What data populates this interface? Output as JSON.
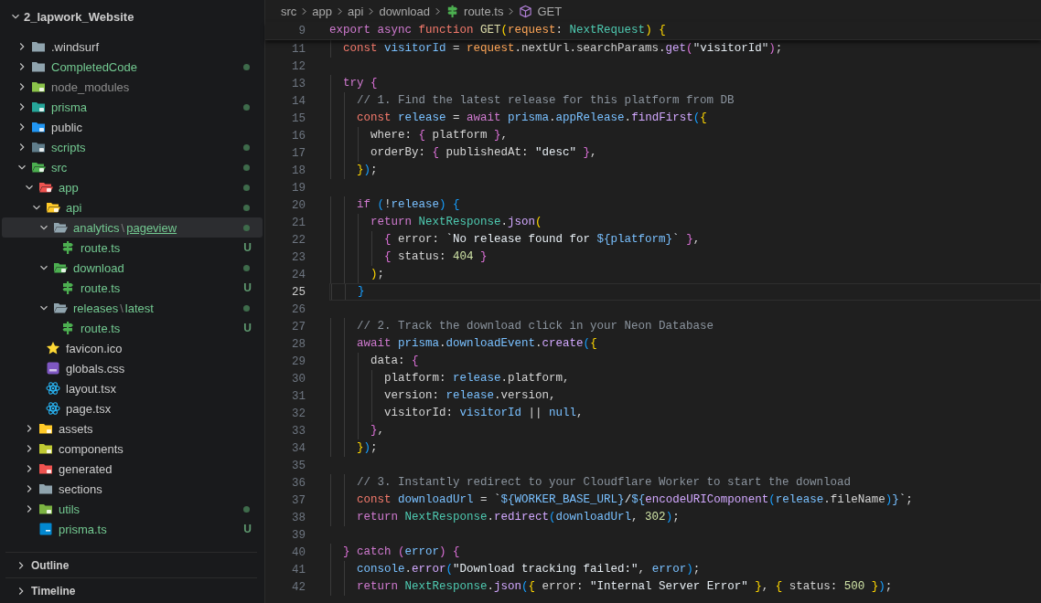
{
  "explorer": {
    "project": {
      "name": "2_lapwork_Website",
      "expanded": true
    },
    "tree": [
      {
        "kind": "folder",
        "name": ".windsurf",
        "color": "#cccccc",
        "expanded": false,
        "selected": false
      },
      {
        "kind": "folder",
        "name": "CompletedCode",
        "color": "#73c991",
        "dot": true,
        "expanded": false,
        "selected": false
      },
      {
        "kind": "nodefolder",
        "name": "node_modules",
        "color": "#8c8c8c",
        "expanded": false,
        "selected": false
      },
      {
        "kind": "prismafolder",
        "name": "prisma",
        "color": "#73c991",
        "dot": true,
        "expanded": false,
        "selected": false
      },
      {
        "kind": "publicfolder",
        "name": "public",
        "color": "#cccccc",
        "expanded": false,
        "selected": false
      },
      {
        "kind": "scriptsfolder",
        "name": "scripts",
        "color": "#73c991",
        "dot": true,
        "expanded": false,
        "selected": false
      },
      {
        "kind": "srcfolder",
        "name": "src",
        "color": "#73c991",
        "dot": true,
        "expanded": true,
        "selected": false,
        "children": [
          {
            "kind": "appfolder",
            "name": "app",
            "color": "#73c991",
            "dot": true,
            "expanded": true,
            "selected": false,
            "children": [
              {
                "kind": "apifolder",
                "name": "api",
                "color": "#73c991",
                "dot": true,
                "expanded": true,
                "selected": false,
                "children": [
                  {
                    "kind": "folder",
                    "parts": [
                      "analytics",
                      "\\",
                      "pageview"
                    ],
                    "color": "#73c991",
                    "dot": true,
                    "expanded": true,
                    "selected": true,
                    "children": [
                      {
                        "kind": "route",
                        "name": "route.ts",
                        "color": "#73c991",
                        "badge": "U",
                        "selected": false
                      }
                    ]
                  },
                  {
                    "kind": "downloadfolder",
                    "name": "download",
                    "color": "#73c991",
                    "dot": true,
                    "expanded": true,
                    "selected": false,
                    "children": [
                      {
                        "kind": "route",
                        "name": "route.ts",
                        "color": "#73c991",
                        "badge": "U",
                        "selected": false
                      }
                    ]
                  },
                  {
                    "kind": "folder",
                    "parts": [
                      "releases",
                      "\\",
                      "latest"
                    ],
                    "color": "#73c991",
                    "dot": true,
                    "expanded": true,
                    "selected": false,
                    "children": [
                      {
                        "kind": "route",
                        "name": "route.ts",
                        "color": "#73c991",
                        "badge": "U",
                        "selected": false
                      }
                    ]
                  }
                ]
              },
              {
                "kind": "favicon",
                "name": "favicon.ico",
                "color": "#cccccc",
                "selected": false
              },
              {
                "kind": "stylesheet",
                "name": "globals.css",
                "color": "#cccccc",
                "selected": false
              },
              {
                "kind": "react",
                "name": "layout.tsx",
                "color": "#cccccc",
                "selected": false
              },
              {
                "kind": "react",
                "name": "page.tsx",
                "color": "#cccccc",
                "selected": false
              }
            ]
          },
          {
            "kind": "assetsfolder",
            "name": "assets",
            "color": "#cccccc",
            "expanded": false,
            "selected": false
          },
          {
            "kind": "componentsfolder",
            "name": "components",
            "color": "#cccccc",
            "expanded": false,
            "selected": false
          },
          {
            "kind": "generatedfolder",
            "name": "generated",
            "color": "#cccccc",
            "expanded": false,
            "selected": false
          },
          {
            "kind": "folder",
            "name": "sections",
            "color": "#cccccc",
            "expanded": false,
            "selected": false
          },
          {
            "kind": "utilsfolder",
            "name": "utils",
            "color": "#73c991",
            "dot": true,
            "expanded": false,
            "selected": false
          },
          {
            "kind": "typescript",
            "name": "prisma.ts",
            "color": "#73c991",
            "badge": "U",
            "selected": false
          }
        ]
      }
    ]
  },
  "panels": [
    {
      "title": "Outline",
      "expanded": false
    },
    {
      "title": "Timeline",
      "expanded": false
    }
  ],
  "editor": {
    "breadcrumbs": [
      {
        "text": "src"
      },
      {
        "text": "app"
      },
      {
        "text": "api"
      },
      {
        "text": "download"
      },
      {
        "text": "route.ts",
        "kind": "route"
      },
      {
        "text": "GET",
        "kind": "method"
      }
    ],
    "sticky_line": {
      "number": "9",
      "tokens": [
        {
          "kind": "ctl",
          "text": "export "
        },
        {
          "kind": "ctl",
          "text": "async "
        },
        {
          "kind": "kw",
          "text": "function "
        },
        {
          "kind": "fnd",
          "text": "GET"
        },
        {
          "kind": "b1",
          "text": "("
        },
        {
          "kind": "param",
          "text": "request"
        },
        {
          "kind": "p",
          "text": ": "
        },
        {
          "kind": "type",
          "text": "NextRequest"
        },
        {
          "kind": "b1",
          "text": ")"
        },
        {
          "kind": "b1",
          "text": " {"
        }
      ]
    },
    "lines": [
      {
        "number": "11",
        "active": false,
        "tokens": [
          {
            "kind": "kw",
            "text": "  const "
          },
          {
            "kind": "var",
            "text": "visitorId"
          },
          {
            "kind": "p",
            "text": " = "
          },
          {
            "kind": "param",
            "text": "request"
          },
          {
            "kind": "p",
            "text": ".nextUrl.searchParams."
          },
          {
            "kind": "fn",
            "text": "get"
          },
          {
            "kind": "b2",
            "text": "("
          },
          {
            "kind": "str",
            "text": "\"visitorId\""
          },
          {
            "kind": "b2",
            "text": ")"
          },
          {
            "kind": "p",
            "text": ";"
          }
        ]
      },
      {
        "number": "12",
        "active": false
      },
      {
        "number": "13",
        "active": false,
        "tokens": [
          {
            "kind": "ctl",
            "text": "  try "
          },
          {
            "kind": "b2",
            "text": "{"
          }
        ]
      },
      {
        "number": "14",
        "active": false,
        "tokens": [
          {
            "kind": "com",
            "text": "    // 1. Find the latest release for this platform from DB"
          }
        ]
      },
      {
        "number": "15",
        "active": false,
        "tokens": [
          {
            "kind": "kw",
            "text": "    const "
          },
          {
            "kind": "var",
            "text": "release"
          },
          {
            "kind": "p",
            "text": " = "
          },
          {
            "kind": "ctl",
            "text": "await "
          },
          {
            "kind": "var",
            "text": "prisma"
          },
          {
            "kind": "p",
            "text": "."
          },
          {
            "kind": "var",
            "text": "appRelease"
          },
          {
            "kind": "p",
            "text": "."
          },
          {
            "kind": "fn",
            "text": "findFirst"
          },
          {
            "kind": "b3",
            "text": "("
          },
          {
            "kind": "b1",
            "text": "{"
          }
        ]
      },
      {
        "number": "16",
        "active": false,
        "tokens": [
          {
            "kind": "p",
            "text": "      where: "
          },
          {
            "kind": "b2",
            "text": "{"
          },
          {
            "kind": "p",
            "text": " platform "
          },
          {
            "kind": "b2",
            "text": "}"
          },
          {
            "kind": "p",
            "text": ","
          }
        ]
      },
      {
        "number": "17",
        "active": false,
        "tokens": [
          {
            "kind": "p",
            "text": "      orderBy: "
          },
          {
            "kind": "b2",
            "text": "{"
          },
          {
            "kind": "p",
            "text": " publishedAt: "
          },
          {
            "kind": "str",
            "text": "\"desc\" "
          },
          {
            "kind": "b2",
            "text": "}"
          },
          {
            "kind": "p",
            "text": ","
          }
        ]
      },
      {
        "number": "18",
        "active": false,
        "tokens": [
          {
            "kind": "b1",
            "text": "    }"
          },
          {
            "kind": "b3",
            "text": ")"
          },
          {
            "kind": "p",
            "text": ";"
          }
        ]
      },
      {
        "number": "19",
        "active": false
      },
      {
        "number": "20",
        "active": false,
        "tokens": [
          {
            "kind": "ctl",
            "text": "    if "
          },
          {
            "kind": "b3",
            "text": "("
          },
          {
            "kind": "p",
            "text": "!"
          },
          {
            "kind": "var",
            "text": "release"
          },
          {
            "kind": "b3",
            "text": ")"
          },
          {
            "kind": "b3",
            "text": " {"
          }
        ]
      },
      {
        "number": "21",
        "active": false,
        "tokens": [
          {
            "kind": "ctl",
            "text": "      return "
          },
          {
            "kind": "type",
            "text": "NextResponse"
          },
          {
            "kind": "p",
            "text": "."
          },
          {
            "kind": "fn",
            "text": "json"
          },
          {
            "kind": "b1",
            "text": "("
          }
        ]
      },
      {
        "number": "22",
        "active": false,
        "tokens": [
          {
            "kind": "b2",
            "text": "        {"
          },
          {
            "kind": "p",
            "text": " error: "
          },
          {
            "kind": "str",
            "text": "`No release found for "
          },
          {
            "kind": "tpl",
            "text": "${"
          },
          {
            "kind": "var",
            "text": "platform"
          },
          {
            "kind": "tpl",
            "text": "}"
          },
          {
            "kind": "str",
            "text": "` "
          },
          {
            "kind": "b2",
            "text": "}"
          },
          {
            "kind": "p",
            "text": ","
          }
        ]
      },
      {
        "number": "23",
        "active": false,
        "tokens": [
          {
            "kind": "b2",
            "text": "        {"
          },
          {
            "kind": "p",
            "text": " status: "
          },
          {
            "kind": "num",
            "text": "404 "
          },
          {
            "kind": "b2",
            "text": "}"
          }
        ]
      },
      {
        "number": "24",
        "active": false,
        "tokens": [
          {
            "kind": "b1",
            "text": "      )"
          },
          {
            "kind": "p",
            "text": ";"
          }
        ]
      },
      {
        "number": "25",
        "active": true,
        "tokens": [
          {
            "kind": "b3",
            "text": "    }"
          }
        ]
      },
      {
        "number": "26",
        "active": false
      },
      {
        "number": "27",
        "active": false,
        "tokens": [
          {
            "kind": "com",
            "text": "    // 2. Track the download click in your Neon Database"
          }
        ]
      },
      {
        "number": "28",
        "active": false,
        "tokens": [
          {
            "kind": "ctl",
            "text": "    await "
          },
          {
            "kind": "var",
            "text": "prisma"
          },
          {
            "kind": "p",
            "text": "."
          },
          {
            "kind": "var",
            "text": "downloadEvent"
          },
          {
            "kind": "p",
            "text": "."
          },
          {
            "kind": "fn",
            "text": "create"
          },
          {
            "kind": "b3",
            "text": "("
          },
          {
            "kind": "b1",
            "text": "{"
          }
        ]
      },
      {
        "number": "29",
        "active": false,
        "tokens": [
          {
            "kind": "p",
            "text": "      data: "
          },
          {
            "kind": "b2",
            "text": "{"
          }
        ]
      },
      {
        "number": "30",
        "active": false,
        "tokens": [
          {
            "kind": "p",
            "text": "        platform: "
          },
          {
            "kind": "var",
            "text": "release"
          },
          {
            "kind": "p",
            "text": ".platform,"
          }
        ]
      },
      {
        "number": "31",
        "active": false,
        "tokens": [
          {
            "kind": "p",
            "text": "        version: "
          },
          {
            "kind": "var",
            "text": "release"
          },
          {
            "kind": "p",
            "text": ".version,"
          }
        ]
      },
      {
        "number": "32",
        "active": false,
        "tokens": [
          {
            "kind": "p",
            "text": "        visitorId: "
          },
          {
            "kind": "var",
            "text": "visitorId"
          },
          {
            "kind": "p",
            "text": " || "
          },
          {
            "kind": "var",
            "text": "null"
          },
          {
            "kind": "p",
            "text": ","
          }
        ]
      },
      {
        "number": "33",
        "active": false,
        "tokens": [
          {
            "kind": "b2",
            "text": "      }"
          },
          {
            "kind": "p",
            "text": ","
          }
        ]
      },
      {
        "number": "34",
        "active": false,
        "tokens": [
          {
            "kind": "b1",
            "text": "    }"
          },
          {
            "kind": "b3",
            "text": ")"
          },
          {
            "kind": "p",
            "text": ";"
          }
        ]
      },
      {
        "number": "35",
        "active": false
      },
      {
        "number": "36",
        "active": false,
        "tokens": [
          {
            "kind": "com",
            "text": "    // 3. Instantly redirect to your Cloudflare Worker to start the download"
          }
        ]
      },
      {
        "number": "37",
        "active": false,
        "tokens": [
          {
            "kind": "kw",
            "text": "    const "
          },
          {
            "kind": "var",
            "text": "downloadUrl"
          },
          {
            "kind": "p",
            "text": " = "
          },
          {
            "kind": "str",
            "text": "`"
          },
          {
            "kind": "tpl",
            "text": "${"
          },
          {
            "kind": "var",
            "text": "WORKER_BASE_URL"
          },
          {
            "kind": "tpl",
            "text": "}"
          },
          {
            "kind": "str",
            "text": "/"
          },
          {
            "kind": "tpl",
            "text": "${"
          },
          {
            "kind": "fn",
            "text": "encodeURIComponent"
          },
          {
            "kind": "b3",
            "text": "("
          },
          {
            "kind": "var",
            "text": "release"
          },
          {
            "kind": "p",
            "text": ".fileName"
          },
          {
            "kind": "b3",
            "text": ")"
          },
          {
            "kind": "tpl",
            "text": "}"
          },
          {
            "kind": "str",
            "text": "`"
          },
          {
            "kind": "p",
            "text": ";"
          }
        ]
      },
      {
        "number": "38",
        "active": false,
        "tokens": [
          {
            "kind": "ctl",
            "text": "    return "
          },
          {
            "kind": "type",
            "text": "NextResponse"
          },
          {
            "kind": "p",
            "text": "."
          },
          {
            "kind": "fn",
            "text": "redirect"
          },
          {
            "kind": "b3",
            "text": "("
          },
          {
            "kind": "var",
            "text": "downloadUrl"
          },
          {
            "kind": "p",
            "text": ", "
          },
          {
            "kind": "num",
            "text": "302"
          },
          {
            "kind": "b3",
            "text": ")"
          },
          {
            "kind": "p",
            "text": ";"
          }
        ]
      },
      {
        "number": "39",
        "active": false
      },
      {
        "number": "40",
        "active": false,
        "tokens": [
          {
            "kind": "b2",
            "text": "  }"
          },
          {
            "kind": "ctl",
            "text": " catch "
          },
          {
            "kind": "b2",
            "text": "("
          },
          {
            "kind": "var",
            "text": "error"
          },
          {
            "kind": "b2",
            "text": ")"
          },
          {
            "kind": "b2",
            "text": " {"
          }
        ]
      },
      {
        "number": "41",
        "active": false,
        "tokens": [
          {
            "kind": "var",
            "text": "    console"
          },
          {
            "kind": "p",
            "text": "."
          },
          {
            "kind": "fn",
            "text": "error"
          },
          {
            "kind": "b3",
            "text": "("
          },
          {
            "kind": "str",
            "text": "\"Download tracking failed:\""
          },
          {
            "kind": "p",
            "text": ", "
          },
          {
            "kind": "var",
            "text": "error"
          },
          {
            "kind": "b3",
            "text": ")"
          },
          {
            "kind": "p",
            "text": ";"
          }
        ]
      },
      {
        "number": "42",
        "active": false,
        "tokens": [
          {
            "kind": "ctl",
            "text": "    return "
          },
          {
            "kind": "type",
            "text": "NextResponse"
          },
          {
            "kind": "p",
            "text": "."
          },
          {
            "kind": "fn",
            "text": "json"
          },
          {
            "kind": "b3",
            "text": "("
          },
          {
            "kind": "b1",
            "text": "{"
          },
          {
            "kind": "p",
            "text": " error: "
          },
          {
            "kind": "str",
            "text": "\"Internal Server Error\" "
          },
          {
            "kind": "b1",
            "text": "}"
          },
          {
            "kind": "p",
            "text": ", "
          },
          {
            "kind": "b1",
            "text": "{"
          },
          {
            "kind": "p",
            "text": " status: "
          },
          {
            "kind": "num",
            "text": "500 "
          },
          {
            "kind": "b1",
            "text": "}"
          },
          {
            "kind": "b3",
            "text": ")"
          },
          {
            "kind": "p",
            "text": ";"
          }
        ]
      }
    ]
  }
}
